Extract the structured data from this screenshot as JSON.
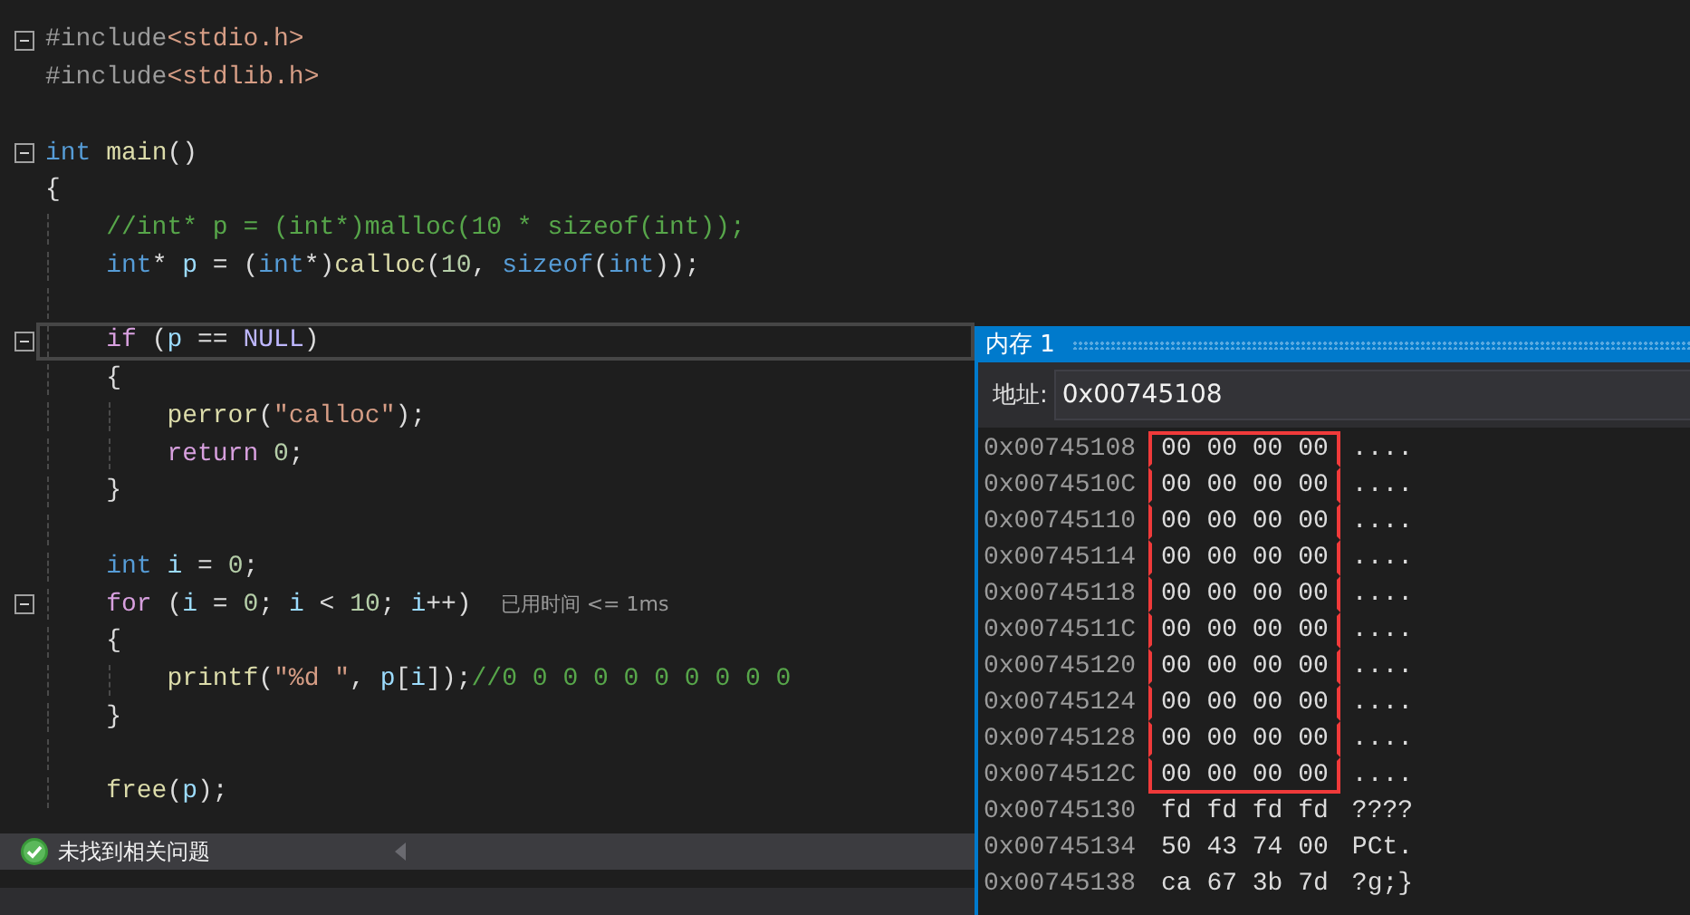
{
  "editor": {
    "lines": [
      {
        "fold": true,
        "current": false,
        "tokens": [
          {
            "kind": "preprocessor",
            "text": "#include"
          },
          {
            "kind": "include",
            "text": "<stdio.h>"
          }
        ]
      },
      {
        "fold": false,
        "current": false,
        "tokens": [
          {
            "kind": "preprocessor",
            "text": "#include"
          },
          {
            "kind": "include",
            "text": "<stdlib.h>"
          }
        ]
      },
      {
        "fold": false,
        "current": false
      },
      {
        "fold": true,
        "current": false,
        "tokens": [
          {
            "kind": "keyword",
            "text": "int"
          },
          {
            "kind": "function",
            "text": " main"
          },
          {
            "kind": "plain",
            "text": "()"
          }
        ]
      },
      {
        "fold": false,
        "current": false,
        "tokens": [
          {
            "kind": "plain",
            "text": "{"
          }
        ],
        "children": [
          {
            "fold": false,
            "current": false,
            "tokens": [
              {
                "kind": "comment",
                "text": "//int* p = (int*)malloc(10 * sizeof(int));"
              }
            ]
          },
          {
            "fold": false,
            "current": false,
            "tokens": [
              {
                "kind": "keyword",
                "text": "int"
              },
              {
                "kind": "plain",
                "text": "* "
              },
              {
                "kind": "variable",
                "text": "p"
              },
              {
                "kind": "plain",
                "text": " = ("
              },
              {
                "kind": "keyword",
                "text": "int"
              },
              {
                "kind": "plain",
                "text": "*)"
              },
              {
                "kind": "function",
                "text": "calloc"
              },
              {
                "kind": "plain",
                "text": "("
              },
              {
                "kind": "number",
                "text": "10"
              },
              {
                "kind": "plain",
                "text": ", "
              },
              {
                "kind": "keyword",
                "text": "sizeof"
              },
              {
                "kind": "plain",
                "text": "("
              },
              {
                "kind": "keyword",
                "text": "int"
              },
              {
                "kind": "plain",
                "text": "));"
              }
            ]
          },
          {
            "fold": false,
            "current": false
          },
          {
            "fold": true,
            "current": true,
            "tokens": [
              {
                "kind": "control",
                "text": "if"
              },
              {
                "kind": "plain",
                "text": " ("
              },
              {
                "kind": "variable",
                "text": "p"
              },
              {
                "kind": "plain",
                "text": " == "
              },
              {
                "kind": "macro",
                "text": "NULL"
              },
              {
                "kind": "plain",
                "text": ")"
              }
            ]
          },
          {
            "fold": false,
            "current": false,
            "tokens": [
              {
                "kind": "plain",
                "text": "{"
              }
            ],
            "children": [
              {
                "fold": false,
                "current": false,
                "tokens": [
                  {
                    "kind": "function",
                    "text": "perror"
                  },
                  {
                    "kind": "plain",
                    "text": "("
                  },
                  {
                    "kind": "string",
                    "text": "\"calloc\""
                  },
                  {
                    "kind": "plain",
                    "text": ");"
                  }
                ]
              },
              {
                "fold": false,
                "current": false,
                "tokens": [
                  {
                    "kind": "control",
                    "text": "return"
                  },
                  {
                    "kind": "number",
                    "text": " 0"
                  },
                  {
                    "kind": "plain",
                    "text": ";"
                  }
                ]
              }
            ]
          },
          {
            "fold": false,
            "current": false,
            "tokens": [
              {
                "kind": "plain",
                "text": "}"
              }
            ]
          },
          {
            "fold": false,
            "current": false
          },
          {
            "fold": false,
            "current": false,
            "tokens": [
              {
                "kind": "keyword",
                "text": "int"
              },
              {
                "kind": "variable",
                "text": " i"
              },
              {
                "kind": "plain",
                "text": " = "
              },
              {
                "kind": "number",
                "text": "0"
              },
              {
                "kind": "plain",
                "text": ";"
              }
            ]
          },
          {
            "fold": true,
            "current": false,
            "hint": "已用时间 <= 1ms",
            "tokens": [
              {
                "kind": "control",
                "text": "for"
              },
              {
                "kind": "plain",
                "text": " ("
              },
              {
                "kind": "variable",
                "text": "i"
              },
              {
                "kind": "plain",
                "text": " = "
              },
              {
                "kind": "number",
                "text": "0"
              },
              {
                "kind": "plain",
                "text": "; "
              },
              {
                "kind": "variable",
                "text": "i"
              },
              {
                "kind": "plain",
                "text": " < "
              },
              {
                "kind": "number",
                "text": "10"
              },
              {
                "kind": "plain",
                "text": "; "
              },
              {
                "kind": "variable",
                "text": "i"
              },
              {
                "kind": "plain",
                "text": "++)"
              }
            ]
          },
          {
            "fold": false,
            "current": false,
            "tokens": [
              {
                "kind": "plain",
                "text": "{"
              }
            ],
            "children": [
              {
                "fold": false,
                "current": false,
                "tokens": [
                  {
                    "kind": "function",
                    "text": "printf"
                  },
                  {
                    "kind": "plain",
                    "text": "("
                  },
                  {
                    "kind": "string",
                    "text": "\"%d \""
                  },
                  {
                    "kind": "plain",
                    "text": ", "
                  },
                  {
                    "kind": "variable",
                    "text": "p"
                  },
                  {
                    "kind": "plain",
                    "text": "["
                  },
                  {
                    "kind": "variable",
                    "text": "i"
                  },
                  {
                    "kind": "plain",
                    "text": "]);"
                  },
                  {
                    "kind": "comment",
                    "text": "//0 0 0 0 0 0 0 0 0 0"
                  }
                ]
              }
            ]
          },
          {
            "fold": false,
            "current": false,
            "tokens": [
              {
                "kind": "plain",
                "text": "}"
              }
            ]
          },
          {
            "fold": false,
            "current": false
          },
          {
            "fold": false,
            "current": false,
            "tokens": [
              {
                "kind": "function",
                "text": "free"
              },
              {
                "kind": "plain",
                "text": "("
              },
              {
                "kind": "variable",
                "text": "p"
              },
              {
                "kind": "plain",
                "text": ");"
              }
            ]
          }
        ]
      }
    ]
  },
  "status_bar": {
    "ok": true,
    "message": "未找到相关问题"
  },
  "memory_window": {
    "title": "内存 1",
    "address_label": "地址:",
    "address": "0x00745108",
    "rows": [
      {
        "address": "0x00745108",
        "bytes": "00 00 00 00",
        "ascii": "....",
        "boxed": true
      },
      {
        "address": "0x0074510C",
        "bytes": "00 00 00 00",
        "ascii": "....",
        "boxed": true
      },
      {
        "address": "0x00745110",
        "bytes": "00 00 00 00",
        "ascii": "....",
        "boxed": true
      },
      {
        "address": "0x00745114",
        "bytes": "00 00 00 00",
        "ascii": "....",
        "boxed": true
      },
      {
        "address": "0x00745118",
        "bytes": "00 00 00 00",
        "ascii": "....",
        "boxed": true
      },
      {
        "address": "0x0074511C",
        "bytes": "00 00 00 00",
        "ascii": "....",
        "boxed": true
      },
      {
        "address": "0x00745120",
        "bytes": "00 00 00 00",
        "ascii": "....",
        "boxed": true
      },
      {
        "address": "0x00745124",
        "bytes": "00 00 00 00",
        "ascii": "....",
        "boxed": true
      },
      {
        "address": "0x00745128",
        "bytes": "00 00 00 00",
        "ascii": "....",
        "boxed": true
      },
      {
        "address": "0x0074512C",
        "bytes": "00 00 00 00",
        "ascii": "....",
        "boxed": true
      },
      {
        "address": "0x00745130",
        "bytes": "fd fd fd fd",
        "ascii": "????",
        "boxed": false
      },
      {
        "address": "0x00745134",
        "bytes": "50 43 74 00",
        "ascii": "PCt.",
        "boxed": false
      },
      {
        "address": "0x00745138",
        "bytes": "ca 67 3b 7d",
        "ascii": "?g;}",
        "boxed": false
      }
    ]
  }
}
